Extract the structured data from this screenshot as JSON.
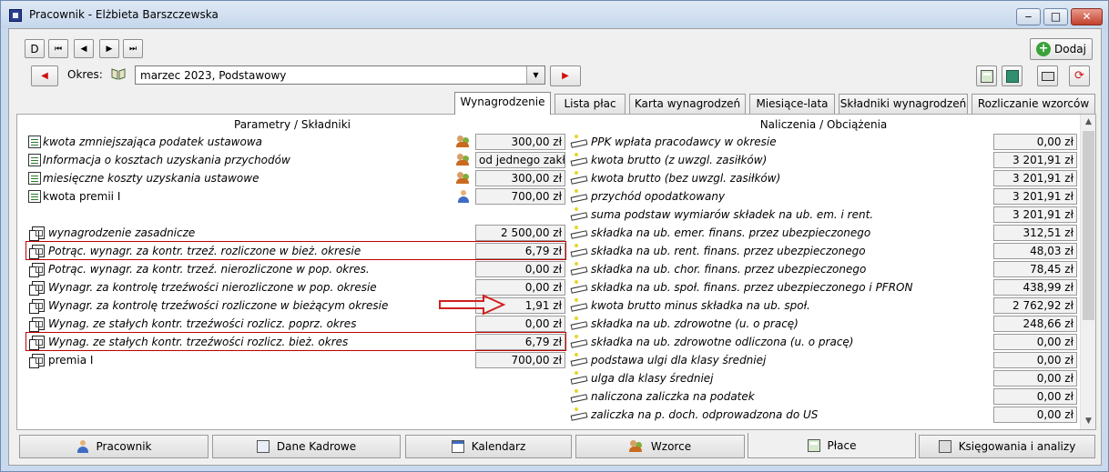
{
  "window": {
    "title": "Pracownik - Elżbieta Barszczewska",
    "min": "‒",
    "max": "□",
    "close": "✕"
  },
  "nav": {
    "first": "D",
    "prev_all": "⏮",
    "prev": "◀",
    "next": "▶",
    "last": "⏭"
  },
  "toolbar": {
    "add_label": "Dodaj"
  },
  "okres": {
    "label": "Okres:",
    "value": "marzec 2023, Podstawowy"
  },
  "tabs": [
    {
      "label": "Wynagrodzenie",
      "active": true
    },
    {
      "label": "Lista płac"
    },
    {
      "label": "Karta wynagrodzeń"
    },
    {
      "label": "Miesiące-lata"
    },
    {
      "label": "Składniki wynagrodzeń"
    },
    {
      "label": "Rozliczanie wzorców"
    }
  ],
  "left": {
    "header": "Parametry / Składniki",
    "rows": [
      {
        "label": "kwota zmniejszająca podatek ustawowa",
        "value": "300,00 zł",
        "italic": true,
        "icon": "doc-icon",
        "badge": "people-icon"
      },
      {
        "label": "Informacja o kosztach uzyskania przychodów",
        "value": "od jednego zakł...",
        "italic": true,
        "icon": "doc-icon",
        "badge": "people-icon"
      },
      {
        "label": "miesięczne koszty uzyskania ustawowe",
        "value": "300,00 zł",
        "italic": true,
        "icon": "doc-icon",
        "badge": "people-icon"
      },
      {
        "label": "kwota premii I",
        "value": "700,00 zł",
        "italic": false,
        "icon": "doc-icon",
        "badge": "person-icon"
      },
      {
        "label": "",
        "value": "",
        "icon": ""
      },
      {
        "label": "wynagrodzenie zasadnicze",
        "value": "2 500,00 zł",
        "italic": true,
        "icon": "copy-icon"
      },
      {
        "label": "Potrąc. wynagr. za kontr. trzeź. rozliczone w bież. okresie",
        "value": "6,79 zł",
        "italic": true,
        "icon": "copy-icon",
        "highlight": true
      },
      {
        "label": "Potrąc. wynagr. za kontr. trzeź. nierozliczone w pop. okres.",
        "value": "0,00 zł",
        "italic": true,
        "icon": "copy-icon"
      },
      {
        "label": "Wynagr. za kontrolę trzeźwości nierozliczone w pop. okresie",
        "value": "0,00 zł",
        "italic": true,
        "icon": "copy-icon"
      },
      {
        "label": "Wynagr. za kontrolę trzeźwości rozliczone w bieżącym okresie",
        "value": "1,91 zł",
        "italic": true,
        "icon": "copy-icon",
        "arrow": true
      },
      {
        "label": "Wynag. ze stałych kontr. trzeźwości rozlicz. poprz. okres",
        "value": "0,00 zł",
        "italic": true,
        "icon": "copy-icon"
      },
      {
        "label": "Wynag. ze stałych kontr. trzeźwości rozlicz. bież. okres",
        "value": "6,79 zł",
        "italic": true,
        "icon": "copy-icon",
        "highlight": true
      },
      {
        "label": "premia I",
        "value": "700,00 zł",
        "italic": false,
        "icon": "copy-icon"
      }
    ]
  },
  "right": {
    "header": "Naliczenia / Obciążenia",
    "rows": [
      {
        "label": "PPK wpłata pracodawcy w okresie",
        "value": "0,00 zł"
      },
      {
        "label": "kwota brutto (z uwzgl. zasiłków)",
        "value": "3 201,91 zł"
      },
      {
        "label": "kwota brutto (bez uwzgl. zasiłków)",
        "value": "3 201,91 zł"
      },
      {
        "label": "przychód opodatkowany",
        "value": "3 201,91 zł"
      },
      {
        "label": "suma podstaw wymiarów składek na ub. em. i rent.",
        "value": "3 201,91 zł"
      },
      {
        "label": "składka na ub. emer. finans. przez ubezpieczonego",
        "value": "312,51 zł"
      },
      {
        "label": "składka na ub. rent. finans. przez ubezpieczonego",
        "value": "48,03 zł"
      },
      {
        "label": "składka na ub. chor. finans. przez ubezpieczonego",
        "value": "78,45 zł"
      },
      {
        "label": "składka na ub. społ. finans. przez ubezpieczonego i PFRON",
        "value": "438,99 zł"
      },
      {
        "label": "kwota brutto minus składka na ub. społ.",
        "value": "2 762,92 zł"
      },
      {
        "label": "składka na ub. zdrowotne (u. o pracę)",
        "value": "248,66 zł"
      },
      {
        "label": "składka na ub. zdrowotne odliczona (u. o pracę)",
        "value": "0,00 zł"
      },
      {
        "label": "podstawa ulgi dla klasy średniej",
        "value": "0,00 zł"
      },
      {
        "label": "ulga dla klasy średniej",
        "value": "0,00 zł"
      },
      {
        "label": "naliczona zaliczka na podatek",
        "value": "0,00 zł"
      },
      {
        "label": "zaliczka na p. doch. odprowadzona do US",
        "value": "0,00 zł"
      }
    ]
  },
  "bottom_tabs": [
    {
      "label": "Pracownik",
      "icon": "person-icon"
    },
    {
      "label": "Dane Kadrowe",
      "icon": "id-card-icon"
    },
    {
      "label": "Kalendarz",
      "icon": "calendar-icon"
    },
    {
      "label": "Wzorce",
      "icon": "people-icon"
    },
    {
      "label": "Płace",
      "icon": "calculator-icon",
      "active": true
    },
    {
      "label": "Księgowania i analizy",
      "icon": "ledger-icon"
    }
  ]
}
